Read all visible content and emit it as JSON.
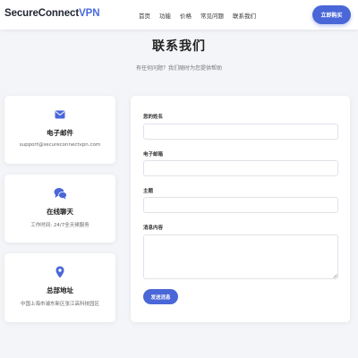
{
  "header": {
    "logo_main": "SecureConnect",
    "logo_accent": "VPN",
    "nav": [
      "首页",
      "功能",
      "价格",
      "常见问题",
      "联系我们"
    ],
    "buy_label": "立即购买"
  },
  "page": {
    "title": "联系我们",
    "subtitle": "有任何问题？我们随时为您提供帮助"
  },
  "cards": {
    "email": {
      "icon": "envelope-icon",
      "title": "电子邮件",
      "text": "support@secureconnectvpn.com"
    },
    "chat": {
      "icon": "chat-bubbles-icon",
      "title": "在线聊天",
      "text": "工作时间: 24/7全天候服务"
    },
    "address": {
      "icon": "map-pin-icon",
      "title": "总部地址",
      "text": "中国上海市浦东新区张江高科技园区"
    }
  },
  "form": {
    "name_label": "您的姓名",
    "name_value": "",
    "email_label": "电子邮箱",
    "email_value": "",
    "subject_label": "主题",
    "subject_value": "",
    "message_label": "消息内容",
    "message_value": "",
    "submit_label": "发送消息"
  },
  "colors": {
    "accent": "#4a67d8",
    "background": "#f4f5f8"
  }
}
